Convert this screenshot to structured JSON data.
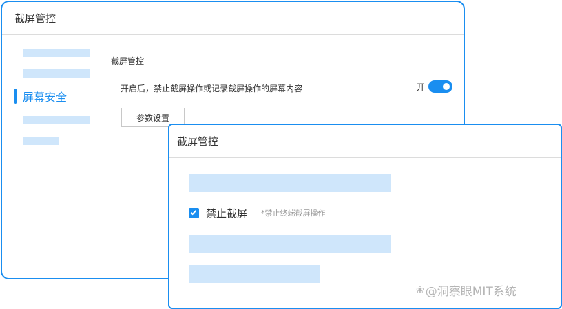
{
  "back_window": {
    "title": "截屏管控",
    "sidebar": {
      "active_item": "屏幕安全"
    },
    "section_title": "截屏管控",
    "description": "开启后，禁止截屏操作或记录截屏操作的屏幕内容",
    "toggle": {
      "label": "开",
      "state": "on"
    },
    "param_button": "参数设置"
  },
  "front_window": {
    "title": "截屏管控",
    "checkbox": {
      "label": "禁止截屏",
      "checked": true,
      "hint": "*禁止终端截屏操作"
    }
  },
  "watermark": {
    "icon": "paw-icon",
    "text": "@洞察眼MIT系统"
  },
  "colors": {
    "accent": "#1a8ef0",
    "placeholder": "#cfe6fb",
    "border": "#dcdcdc"
  }
}
